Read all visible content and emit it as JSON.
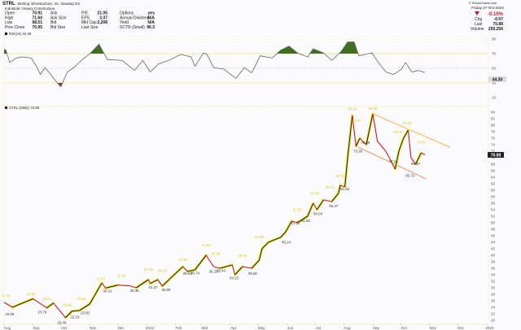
{
  "header": {
    "symbol": "STRL",
    "company": "Sterling Infrastructure, Inc.  Nasdaq GS",
    "industry": "Industrial / Heavy Construction",
    "fields": [
      {
        "label": "Open",
        "value": "70.91"
      },
      {
        "label": "High",
        "value": "71.60"
      },
      {
        "label": "Low",
        "value": "68.51"
      },
      {
        "label": "Prev Close",
        "value": "70.95"
      },
      {
        "label": "Ask",
        "value": ""
      },
      {
        "label": "Ask Size",
        "value": ""
      },
      {
        "label": "Bid",
        "value": ""
      },
      {
        "label": "Bid Size",
        "value": ""
      },
      {
        "label": "P/E",
        "value": "21.05"
      },
      {
        "label": "EPS",
        "value": "3.37"
      },
      {
        "label": "Mkt Cap",
        "value": "2,208"
      },
      {
        "label": "Last Size",
        "value": ""
      },
      {
        "label": "Options",
        "value": "yes"
      },
      {
        "label": "Annual Dividend",
        "value": "N/A"
      },
      {
        "label": "Yield",
        "value": "N/A"
      },
      {
        "label": "SCTR (Small)",
        "value": "96.3"
      }
    ],
    "copyright": "© StockCharts.com",
    "date": "Friday  27-Oct-2023",
    "pct_change": "-0.10%",
    "chg_label": "Chg",
    "chg": "-0.07",
    "last_label": "Last",
    "last": "70.88",
    "volume_label": "Volume",
    "volume": "250,256",
    "down_color": "#c8102e"
  },
  "chart_data": [
    {
      "type": "line",
      "title": "RSI(14) 44.30",
      "current_label": "44.30",
      "ylim": [
        10,
        90
      ],
      "yticks": [
        "90",
        "70",
        "50",
        "30",
        "10"
      ],
      "overbought": 70,
      "oversold": 30,
      "colors": {
        "line": "#666666",
        "overbought_fill": "#3f6f22",
        "oversold_fill": "#8a3a1c",
        "guides": "#e8e23a"
      },
      "points": [
        [
          "2022-08-01",
          76
        ],
        [
          "2022-08-03",
          74.8
        ],
        [
          "2022-08-07",
          58
        ],
        [
          "2022-08-14",
          64
        ],
        [
          "2022-08-21",
          65.5
        ],
        [
          "2022-08-30",
          64
        ],
        [
          "2022-09-05",
          52.5
        ],
        [
          "2022-09-09",
          41.5
        ],
        [
          "2022-09-14",
          51
        ],
        [
          "2022-09-20",
          41.5
        ],
        [
          "2022-09-27",
          30.3
        ],
        [
          "2022-10-01",
          24.8
        ],
        [
          "2022-10-08",
          45
        ],
        [
          "2022-10-15",
          51
        ],
        [
          "2022-10-23",
          60.7
        ],
        [
          "2022-11-02",
          71
        ],
        [
          "2022-11-11",
          83
        ],
        [
          "2022-11-16",
          71
        ],
        [
          "2022-11-20",
          62
        ],
        [
          "2022-12-06",
          60.7
        ],
        [
          "2022-12-19",
          47
        ],
        [
          "2022-12-28",
          60.7
        ],
        [
          "2023-01-05",
          45
        ],
        [
          "2023-01-14",
          56
        ],
        [
          "2023-01-27",
          62
        ],
        [
          "2023-02-07",
          69
        ],
        [
          "2023-02-18",
          65.5
        ],
        [
          "2023-02-22",
          52.5
        ],
        [
          "2023-03-03",
          71
        ],
        [
          "2023-03-07",
          69
        ],
        [
          "2023-03-14",
          51
        ],
        [
          "2023-03-25",
          49
        ],
        [
          "2023-04-07",
          36
        ],
        [
          "2023-04-16",
          51
        ],
        [
          "2023-04-24",
          43.7
        ],
        [
          "2023-05-03",
          67
        ],
        [
          "2023-05-16",
          64
        ],
        [
          "2023-05-25",
          74.8
        ],
        [
          "2023-06-03",
          80.3
        ],
        [
          "2023-06-12",
          71
        ],
        [
          "2023-06-23",
          65.5
        ],
        [
          "2023-06-29",
          76.7
        ],
        [
          "2023-07-10",
          71
        ],
        [
          "2023-07-19",
          60.7
        ],
        [
          "2023-07-29",
          73
        ],
        [
          "2023-08-05",
          86
        ],
        [
          "2023-08-12",
          86
        ],
        [
          "2023-08-17",
          67
        ],
        [
          "2023-08-24",
          69
        ],
        [
          "2023-08-31",
          71
        ],
        [
          "2023-09-07",
          58
        ],
        [
          "2023-09-15",
          45
        ],
        [
          "2023-09-23",
          41.5
        ],
        [
          "2023-10-02",
          49
        ],
        [
          "2023-10-06",
          58
        ],
        [
          "2023-10-13",
          45
        ],
        [
          "2023-10-20",
          47
        ],
        [
          "2023-10-27",
          44.3
        ]
      ]
    },
    {
      "type": "line",
      "title": "STRL (Daily) 70.88",
      "current_label": "70.88",
      "ylim": [
        20,
        84
      ],
      "yticks": [
        "84",
        "82",
        "80",
        "78",
        "76",
        "74",
        "72",
        "70",
        "68",
        "66",
        "64",
        "62",
        "60",
        "58",
        "56",
        "54",
        "52",
        "50",
        "48",
        "46",
        "44",
        "42",
        "40",
        "38",
        "36",
        "34",
        "32",
        "30",
        "28",
        "26",
        "24",
        "22",
        "20"
      ],
      "xticks": [
        [
          "2022-08-01",
          "Aug"
        ],
        [
          "2022-09-01",
          "Sep"
        ],
        [
          "2022-10-01",
          "Oct"
        ],
        [
          "2022-11-01",
          "Nov"
        ],
        [
          "2022-12-01",
          "Dec"
        ],
        [
          "2023-01-01",
          "2023"
        ],
        [
          "2023-02-01",
          "Feb"
        ],
        [
          "2023-03-01",
          "Mar"
        ],
        [
          "2023-04-01",
          "Apr"
        ],
        [
          "2023-05-01",
          "May"
        ],
        [
          "2023-06-01",
          "Jun"
        ],
        [
          "2023-07-01",
          "Jul"
        ],
        [
          "2023-08-01",
          "Aug"
        ],
        [
          "2023-09-01",
          "Sep"
        ],
        [
          "2023-10-01",
          "Oct"
        ],
        [
          "2023-11-01",
          "Nov"
        ],
        [
          "2023-12-01",
          "Dec"
        ],
        [
          "2024-01-01",
          "2024"
        ]
      ],
      "colors": {
        "up": "#222222",
        "down": "#e0101e",
        "halo": "#f2ec3a",
        "channel_upper": "#f5a623",
        "channel_lower": "#f07a3a",
        "label_high": "#d8cc10",
        "label_low": "#333333"
      },
      "points": [
        [
          "2022-08-01",
          25.5
        ],
        [
          "2022-08-10",
          24.0
        ],
        [
          "2022-09-01",
          26.6
        ],
        [
          "2022-09-16",
          23.8
        ],
        [
          "2022-09-23",
          25.3
        ],
        [
          "2022-10-06",
          20.8
        ],
        [
          "2022-10-13",
          22.8
        ],
        [
          "2022-10-21",
          23.0
        ],
        [
          "2022-11-01",
          25.0
        ],
        [
          "2022-11-14",
          31.5
        ],
        [
          "2022-11-18",
          29.9
        ],
        [
          "2022-12-01",
          30.8
        ],
        [
          "2022-12-14",
          30.6
        ],
        [
          "2022-12-21",
          30.0
        ],
        [
          "2023-01-03",
          32.5
        ],
        [
          "2023-01-05",
          31.3
        ],
        [
          "2023-01-13",
          32.5
        ],
        [
          "2023-01-18",
          30.5
        ],
        [
          "2023-01-27",
          33.0
        ],
        [
          "2023-02-09",
          36.5
        ],
        [
          "2023-02-14",
          35.0
        ],
        [
          "2023-02-22",
          35.5
        ],
        [
          "2023-03-06",
          40.0
        ],
        [
          "2023-03-14",
          36.5
        ],
        [
          "2023-03-21",
          36.0
        ],
        [
          "2023-04-03",
          37.0
        ],
        [
          "2023-04-06",
          34.0
        ],
        [
          "2023-04-14",
          36.5
        ],
        [
          "2023-04-24",
          36.0
        ],
        [
          "2023-05-02",
          38.5
        ],
        [
          "2023-05-05",
          42.0
        ],
        [
          "2023-05-12",
          44.0
        ],
        [
          "2023-05-25",
          45.5
        ],
        [
          "2023-05-30",
          47.0
        ],
        [
          "2023-06-06",
          50.5
        ],
        [
          "2023-06-12",
          50.0
        ],
        [
          "2023-06-23",
          52.0
        ],
        [
          "2023-06-29",
          56.0
        ],
        [
          "2023-07-03",
          54.0
        ],
        [
          "2023-07-10",
          57.0
        ],
        [
          "2023-07-19",
          56.5
        ],
        [
          "2023-07-26",
          59.0
        ],
        [
          "2023-07-28",
          61.5
        ],
        [
          "2023-08-02",
          61.0
        ],
        [
          "2023-08-05",
          70.0
        ],
        [
          "2023-08-10",
          83.0
        ],
        [
          "2023-08-14",
          73.5
        ],
        [
          "2023-08-18",
          76.0
        ],
        [
          "2023-08-25",
          74.0
        ],
        [
          "2023-09-01",
          83.5
        ],
        [
          "2023-09-06",
          75.0
        ],
        [
          "2023-09-15",
          72.0
        ],
        [
          "2023-09-25",
          66.5
        ],
        [
          "2023-09-29",
          72.0
        ],
        [
          "2023-10-04",
          76.0
        ],
        [
          "2023-10-09",
          78.5
        ],
        [
          "2023-10-12",
          70.0
        ],
        [
          "2023-10-17",
          68.0
        ],
        [
          "2023-10-23",
          71.5
        ],
        [
          "2023-10-27",
          70.88
        ]
      ],
      "annotations": [
        [
          "2022-08-03",
          26.4,
          "26.40",
          "high"
        ],
        [
          "2022-08-07",
          23.09,
          "23.09",
          "low"
        ],
        [
          "2022-08-30",
          26.89,
          "26.89",
          "high"
        ],
        [
          "2022-09-11",
          23.76,
          "23.76",
          "low"
        ],
        [
          "2022-09-16",
          25.51,
          "25.51",
          "high"
        ],
        [
          "2022-10-02",
          20.46,
          "20.46",
          "low"
        ],
        [
          "2022-10-08",
          23.52,
          "23.52",
          "high"
        ],
        [
          "2022-10-16",
          22.19,
          "22.19",
          "low"
        ],
        [
          "2022-10-23",
          25.52,
          "25.52",
          "high"
        ],
        [
          "2022-10-27",
          23.5,
          "23.50",
          "low"
        ],
        [
          "2022-11-13",
          31.62,
          "31.62",
          "high"
        ],
        [
          "2022-11-20",
          30.21,
          "30.21",
          "low"
        ],
        [
          "2022-12-05",
          32.66,
          "32.66",
          "high"
        ],
        [
          "2022-12-19",
          30.35,
          "30.35",
          "low"
        ],
        [
          "2023-01-03",
          34.56,
          "34.56",
          "high"
        ],
        [
          "2023-01-08",
          31.37,
          "31.37",
          "low"
        ],
        [
          "2023-01-18",
          34.1,
          "34.10",
          "high"
        ],
        [
          "2023-01-22",
          30.6,
          "30.60",
          "low"
        ],
        [
          "2023-02-09",
          37.5,
          "37.50",
          "high"
        ],
        [
          "2023-02-14",
          35.64,
          "35.64",
          "low"
        ],
        [
          "2023-02-22",
          35.74,
          "35.74",
          "low"
        ],
        [
          "2023-03-06",
          41.96,
          "41.96",
          "high"
        ],
        [
          "2023-03-14",
          36.26,
          "36.26",
          "low"
        ],
        [
          "2023-03-22",
          36.44,
          "36.44",
          "low"
        ],
        [
          "2023-03-16",
          39.39,
          "39.39",
          "high"
        ],
        [
          "2023-04-05",
          34.23,
          "34.23",
          "low"
        ],
        [
          "2023-04-14",
          38.8,
          "38.80",
          "high"
        ],
        [
          "2023-04-25",
          35.66,
          "35.66",
          "low"
        ],
        [
          "2023-05-02",
          44.48,
          "44.48",
          "high"
        ],
        [
          "2023-05-31",
          45.24,
          "45.24",
          "low"
        ],
        [
          "2023-06-12",
          52.85,
          "52.85",
          "high"
        ],
        [
          "2023-06-10",
          51.22,
          "51.22",
          "low"
        ],
        [
          "2023-06-21",
          51.82,
          "51.82",
          "low"
        ],
        [
          "2023-07-01",
          57.85,
          "57.85",
          "high"
        ],
        [
          "2023-07-04",
          54.04,
          "54.04",
          "low"
        ],
        [
          "2023-07-17",
          59.74,
          "59.74",
          "high"
        ],
        [
          "2023-07-21",
          56.37,
          "56.37",
          "low"
        ],
        [
          "2023-07-28",
          63.23,
          "63.23",
          "high"
        ],
        [
          "2023-08-02",
          61.62,
          "61.62",
          "low"
        ],
        [
          "2023-08-10",
          83.82,
          "83.82",
          "high"
        ],
        [
          "2023-09-01",
          84.06,
          "84.06",
          "high"
        ],
        [
          "2023-08-15",
          80.27,
          "80.27",
          "high"
        ],
        [
          "2023-08-16",
          73.29,
          "73.29",
          "low"
        ],
        [
          "2023-08-24",
          75.89,
          "75.89",
          "low"
        ],
        [
          "2023-09-23",
          70.14,
          "70.14",
          "low"
        ],
        [
          "2023-09-28",
          76.76,
          "76.76",
          "high"
        ],
        [
          "2023-10-08",
          79.49,
          "79.49",
          "high"
        ],
        [
          "2023-10-11",
          65.72,
          "65.72",
          "low"
        ],
        [
          "2023-10-17",
          69.37,
          "69.37",
          "low"
        ],
        [
          "2023-10-23",
          73.65,
          "73.65",
          "high"
        ]
      ],
      "trendlines": [
        {
          "name": "channel-upper",
          "from": [
            "2023-09-01",
            83.5
          ],
          "to": [
            "2023-11-23",
            73.2
          ]
        },
        {
          "name": "channel-lower",
          "from": [
            "2023-08-16",
            73.29
          ],
          "to": [
            "2023-10-28",
            63.5
          ]
        }
      ]
    }
  ]
}
